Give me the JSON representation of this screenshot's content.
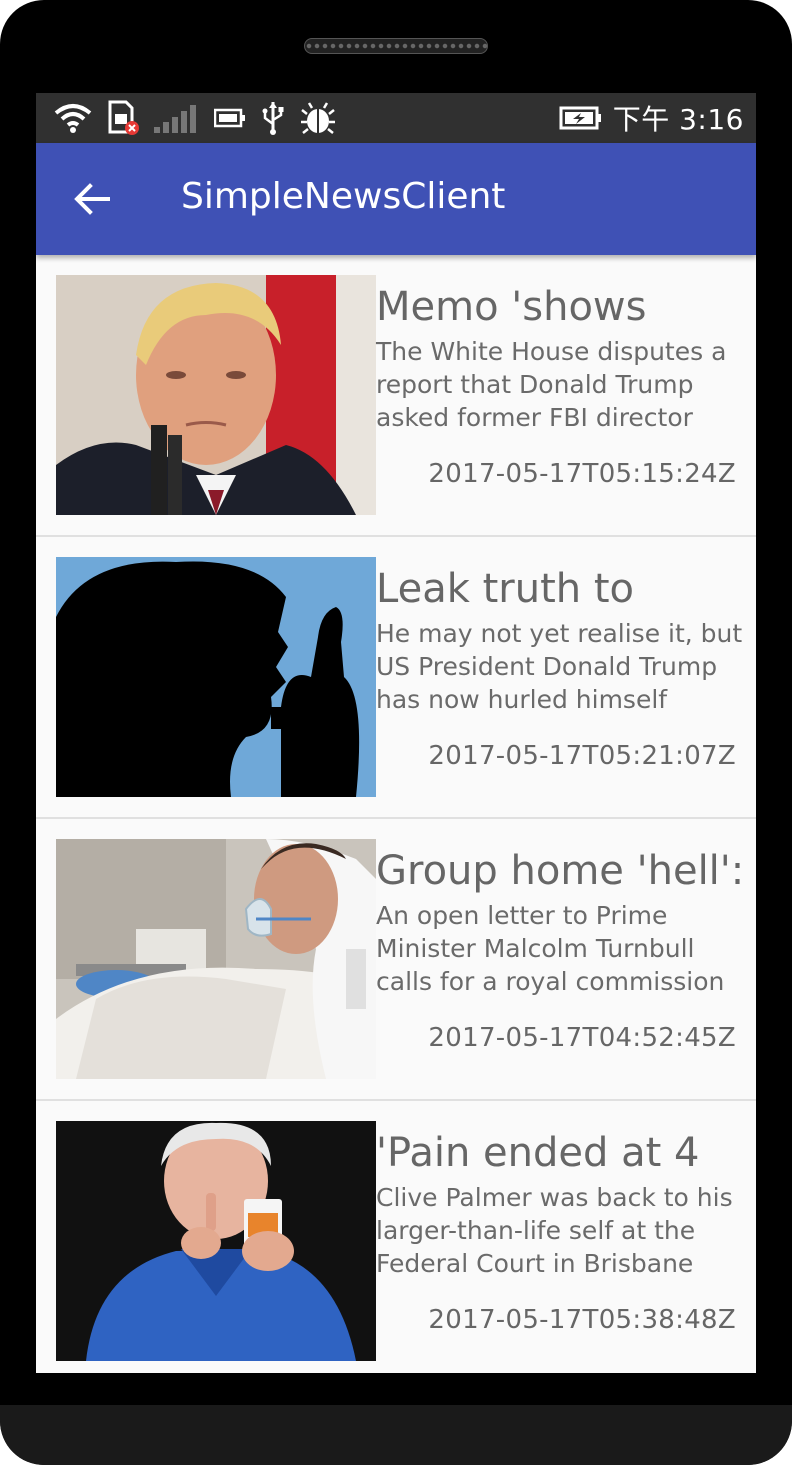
{
  "status_bar": {
    "time": "下午 3:16",
    "icons": [
      "wifi-icon",
      "sim-error-icon",
      "signal-icon",
      "battery-small-icon",
      "usb-icon",
      "debug-icon",
      "battery-charging-icon"
    ]
  },
  "app_bar": {
    "title": "SimpleNewsClient",
    "back_icon": "arrow-back-icon"
  },
  "articles": [
    {
      "headline": "Memo 'shows",
      "description": "The White House disputes a report that Donald Trump asked former FBI director",
      "timestamp": "2017-05-17T05:15:24Z"
    },
    {
      "headline": "Leak truth to",
      "description": "He may not yet realise it, but US President Donald Trump has now hurled himself",
      "timestamp": "2017-05-17T05:21:07Z"
    },
    {
      "headline": "Group home 'hell':",
      "description": "An open letter to Prime Minister Malcolm Turnbull calls for a royal commission",
      "timestamp": "2017-05-17T04:52:45Z"
    },
    {
      "headline": "'Pain ended at 4",
      "description": "Clive Palmer was back to his larger-than-life self at the Federal Court in Brisbane",
      "timestamp": "2017-05-17T05:38:48Z"
    }
  ],
  "colors": {
    "app_bar": "#3f51b5",
    "status_bar": "#303030",
    "background": "#fafafa",
    "text": "#666666"
  }
}
